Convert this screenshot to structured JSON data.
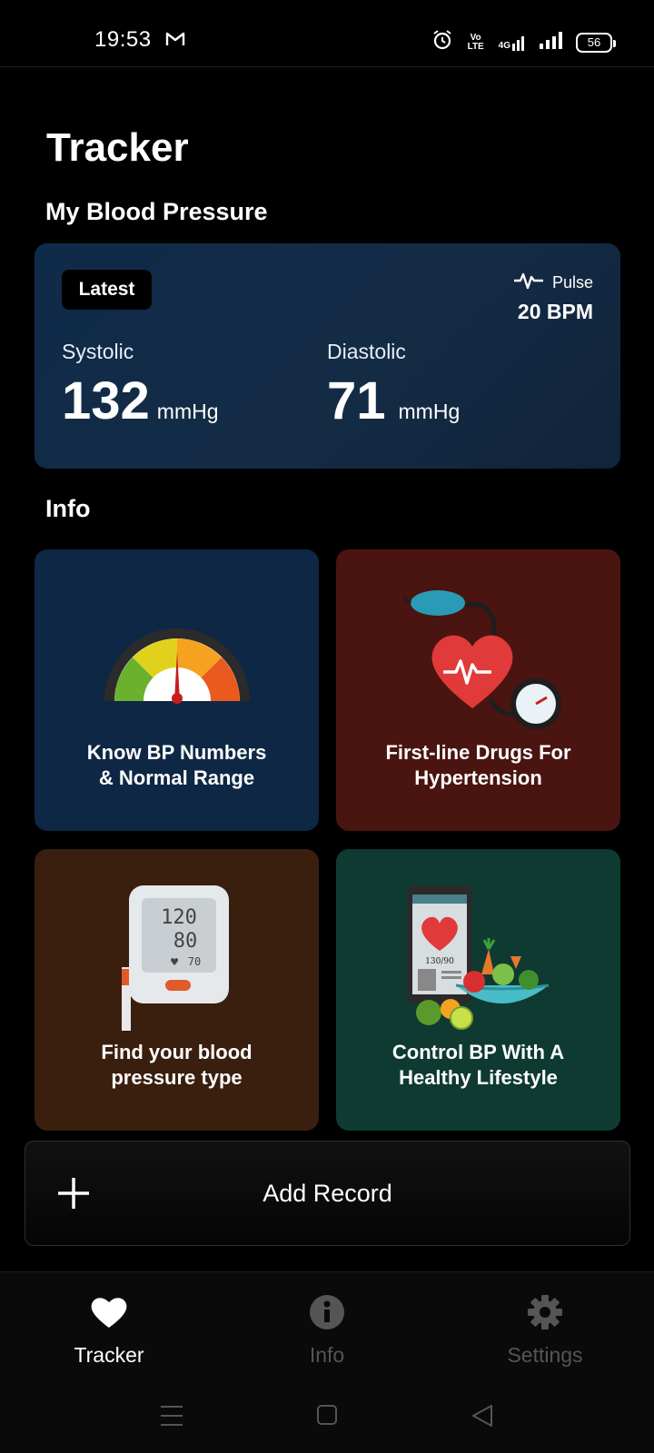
{
  "status_bar": {
    "time": "19:53",
    "network": "4G",
    "volte": "Vo LTE",
    "battery": "56"
  },
  "page": {
    "title": "Tracker"
  },
  "blood_pressure": {
    "section_title": "My Blood Pressure",
    "badge": "Latest",
    "pulse_label": "Pulse",
    "pulse_value": "20 BPM",
    "systolic_label": "Systolic",
    "systolic_value": "132",
    "diastolic_label": "Diastolic",
    "diastolic_value": "71",
    "unit": "mmHg"
  },
  "info": {
    "section_title": "Info",
    "tiles": [
      {
        "caption": "Know BP Numbers\n& Normal Range",
        "color": "#0d2744"
      },
      {
        "caption": "First-line Drugs For\nHypertension",
        "color": "#4a1410"
      },
      {
        "caption": "Find your blood\npressure type",
        "color": "#3a1e0e"
      },
      {
        "caption": "Control BP With A\nHealthy Lifestyle",
        "color": "#0e3a32"
      }
    ],
    "monitor_display": {
      "systolic": "120",
      "diastolic": "80",
      "pulse": "70"
    },
    "phone_display": "130/90"
  },
  "add_record": {
    "label": "Add Record"
  },
  "bottom_nav": {
    "items": [
      {
        "label": "Tracker",
        "active": true
      },
      {
        "label": "Info",
        "active": false
      },
      {
        "label": "Settings",
        "active": false
      }
    ]
  }
}
